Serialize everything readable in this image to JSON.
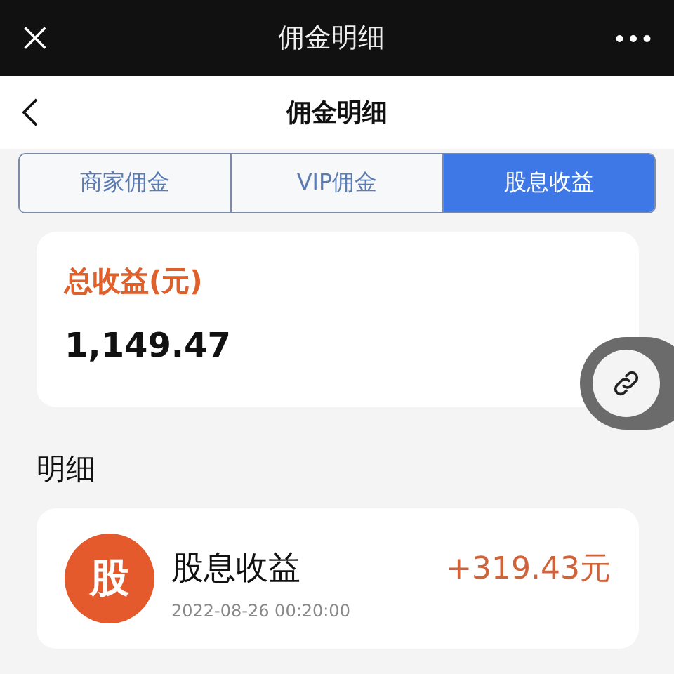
{
  "window": {
    "title": "佣金明细"
  },
  "nav": {
    "title": "佣金明细"
  },
  "tabs": [
    {
      "label": "商家佣金",
      "selected": false
    },
    {
      "label": "VIP佣金",
      "selected": false
    },
    {
      "label": "股息收益",
      "selected": true
    }
  ],
  "summary": {
    "label": "总收益(元)",
    "value": "1,149.47"
  },
  "section_title": "明细",
  "records": [
    {
      "badge": "股",
      "title": "股息收益",
      "time": "2022-08-26 00:20:00",
      "amount": "+319.43元"
    }
  ]
}
